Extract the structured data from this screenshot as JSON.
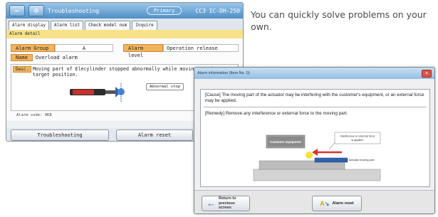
{
  "tagline": "You can quickly solve problems on your own.",
  "back_window": {
    "title": "Troubleshooting",
    "pill": "Primary",
    "code": "CC3 IC-DH-250",
    "tabs": [
      "Alarm display",
      "Alarm list",
      "Check model num",
      "Inquire"
    ],
    "banner": "Alarm detail",
    "alarm_group_label": "Alarm Group",
    "alarm_group_value": "A",
    "alarm_level_label": "Alarm level",
    "alarm_level_value": "Operation release",
    "name_label": "Name",
    "name_value": "Overload alarm",
    "desc_label": "Desc.",
    "desc_text": "Moving part of Elecylinder stopped abnormally while moving to the target position.",
    "abnormal_stop": "Abnormal stop",
    "alarm_code": "Alarm code: 0E8",
    "btn_troubleshooting": "Troubleshooting",
    "btn_alarm_reset": "Alarm reset"
  },
  "front_window": {
    "title": "Alarm information (Item No. 0)",
    "cause": "[Cause] The moving part of the actuator may be interfering with the customer's equipment, or an external force may be applied.",
    "remedy": "[Remedy] Remove any interference or external force to the moving part.",
    "diagram": {
      "customer_equipment": "Customer equipment",
      "interference_line1": "Interference or external force",
      "interference_line2": "is applied.",
      "actuator_moving_part": "Actuator moving part"
    },
    "btn_return_line1": "Return to",
    "btn_return_line2": "previous screen",
    "btn_alarm_reset": "Alarm reset"
  },
  "colors": {
    "title_blue": "#4f8fc6",
    "label_orange": "#f2b35e",
    "banner_yellow": "#f7e28a",
    "arrow_red": "#d9342b",
    "diagram_blue": "#3a73b5"
  }
}
